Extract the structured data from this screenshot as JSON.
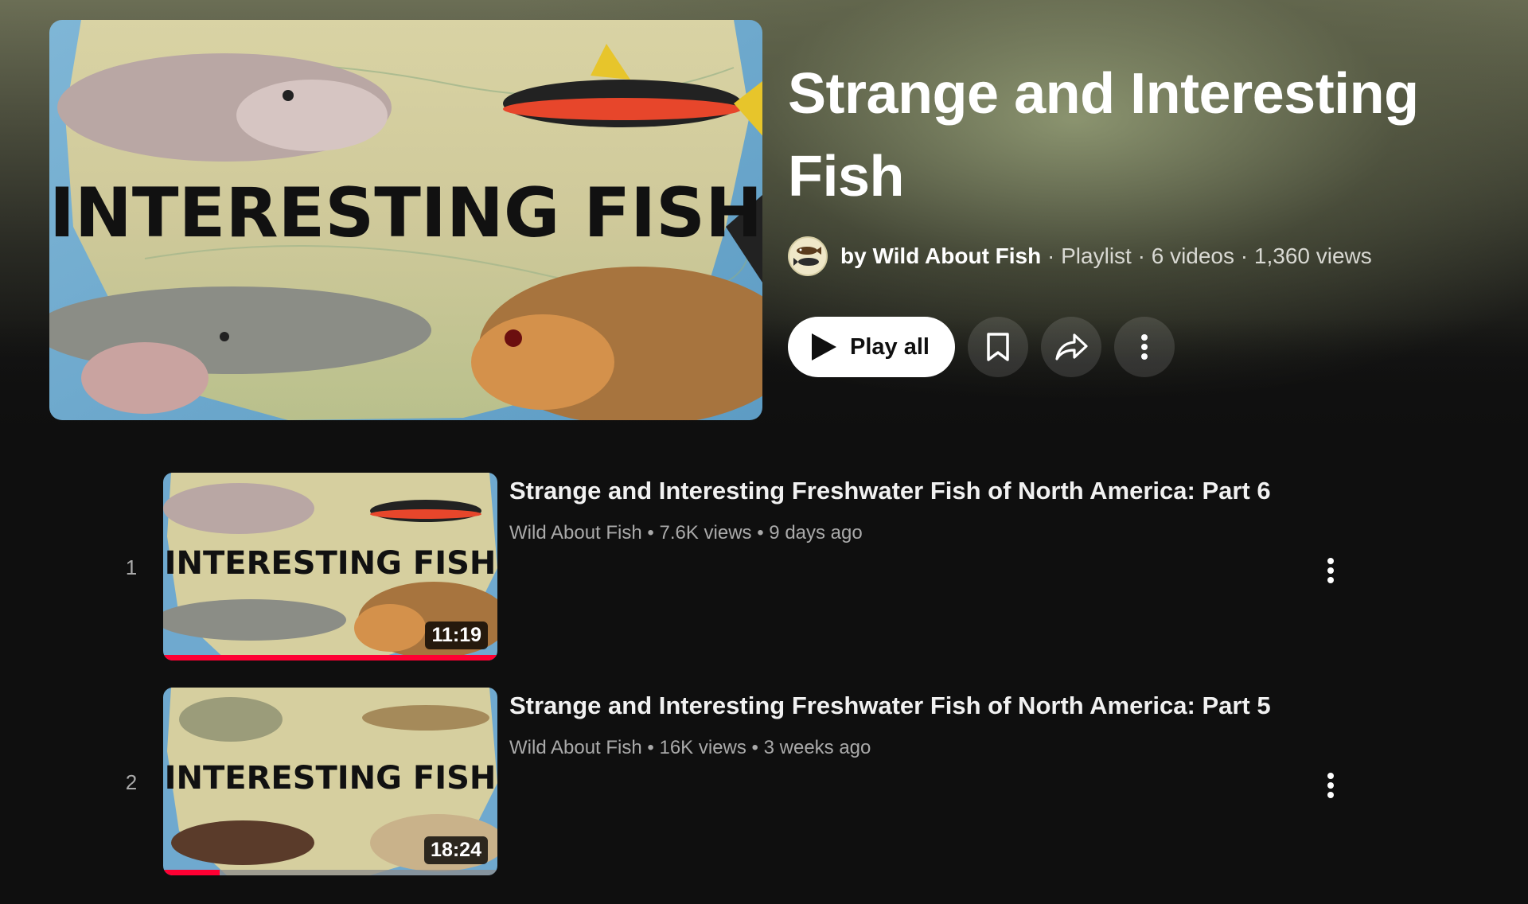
{
  "playlist": {
    "title": "Strange and Interesting Fish",
    "channel": "by Wild About Fish",
    "type": "Playlist",
    "video_count": "6 videos",
    "views": "1,360 views",
    "thumbnail_text": "INTERESTING FISH",
    "separator": "·"
  },
  "actions": {
    "play_all_label": "Play all",
    "save_icon": "bookmark-icon",
    "share_icon": "share-icon",
    "more_icon": "more-vertical-icon"
  },
  "videos": [
    {
      "index": "1",
      "title": "Strange and Interesting Freshwater Fish of North America: Part 6",
      "channel": "Wild About Fish",
      "views": "7.6K views",
      "age": "9 days ago",
      "duration": "11:19",
      "thumbnail_text": "INTERESTING FISH",
      "watched_fraction": 1.0
    },
    {
      "index": "2",
      "title": "Strange and Interesting Freshwater Fish of North America: Part 5",
      "channel": "Wild About Fish",
      "views": "16K views",
      "age": "3 weeks ago",
      "duration": "18:24",
      "thumbnail_text": "INTERESTING FISH",
      "watched_fraction": 0.17
    }
  ],
  "colors": {
    "accent_progress": "#ff0033",
    "background": "#0f0f0f"
  }
}
